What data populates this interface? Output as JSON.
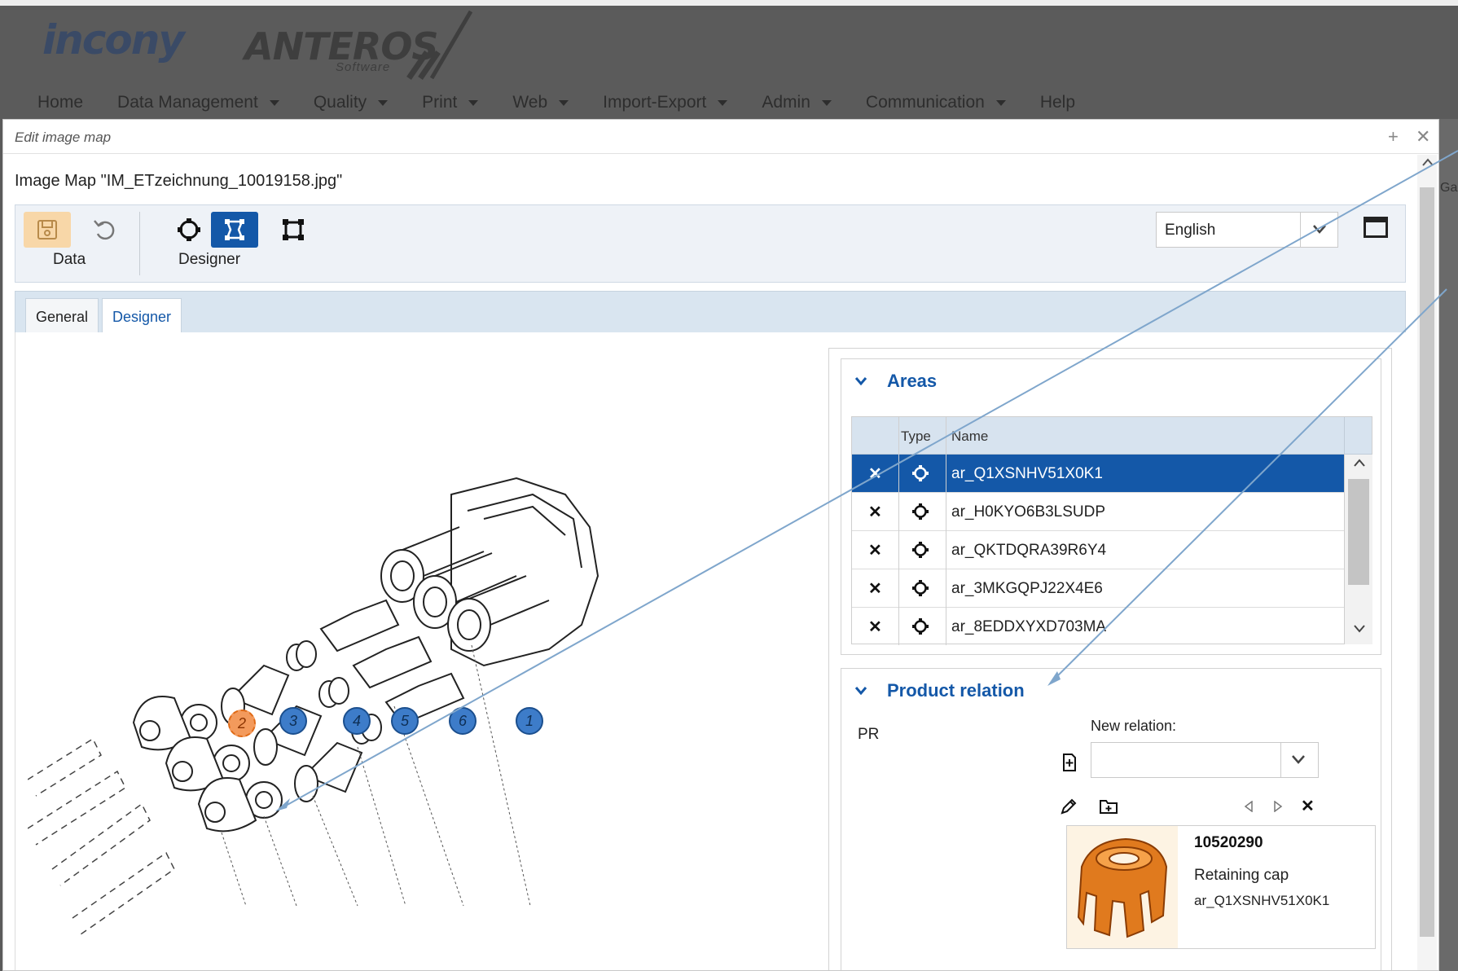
{
  "app": {
    "logo_left": "incony",
    "logo_right": "ANTEROS",
    "logo_sub": "Software",
    "nav": [
      {
        "label": "Home",
        "dropdown": false
      },
      {
        "label": "Data Management",
        "dropdown": true
      },
      {
        "label": "Quality",
        "dropdown": true
      },
      {
        "label": "Print",
        "dropdown": true
      },
      {
        "label": "Web",
        "dropdown": true
      },
      {
        "label": "Import-Export",
        "dropdown": true
      },
      {
        "label": "Admin",
        "dropdown": true
      },
      {
        "label": "Communication",
        "dropdown": true
      },
      {
        "label": "Help",
        "dropdown": false
      }
    ],
    "right_fragment": "Ga"
  },
  "dialog": {
    "title": "Edit image map",
    "image_map_title": "Image Map \"IM_ETzeichnung_10019158.jpg\"",
    "toolbar": {
      "data_label": "Data",
      "designer_label": "Designer",
      "icons": [
        "save-icon",
        "undo-icon",
        "circle-target-icon",
        "designer-icon",
        "rectangle-frame-icon",
        "window-icon"
      ],
      "language": "English"
    },
    "tabs": [
      {
        "label": "General",
        "active": false
      },
      {
        "label": "Designer",
        "active": true
      }
    ],
    "areas": {
      "title": "Areas",
      "columns": [
        "Type",
        "Name"
      ],
      "rows": [
        {
          "name": "ar_Q1XSNHV51X0K1",
          "selected": true
        },
        {
          "name": "ar_H0KYO6B3LSUDP",
          "selected": false
        },
        {
          "name": "ar_QKTDQRA39R6Y4",
          "selected": false
        },
        {
          "name": "ar_3MKGQPJ22X4E6",
          "selected": false
        },
        {
          "name": "ar_8EDDXYXD703MA",
          "selected": false
        }
      ]
    },
    "product_relation": {
      "title": "Product relation",
      "pr_label": "PR",
      "new_relation_label": "New relation:",
      "new_relation_value": "",
      "card": {
        "number": "10520290",
        "name": "Retaining cap",
        "area": "ar_Q1XSNHV51X0K1"
      }
    },
    "markers": [
      {
        "label": "2",
        "active": true
      },
      {
        "label": "3",
        "active": false
      },
      {
        "label": "4",
        "active": false
      },
      {
        "label": "5",
        "active": false
      },
      {
        "label": "6",
        "active": false
      },
      {
        "label": "1",
        "active": false
      }
    ],
    "colors": {
      "accent": "#1458a8",
      "active_marker": "#f39a5c",
      "marker": "#3d7cc9",
      "save_bg": "#f8d7a8"
    }
  }
}
